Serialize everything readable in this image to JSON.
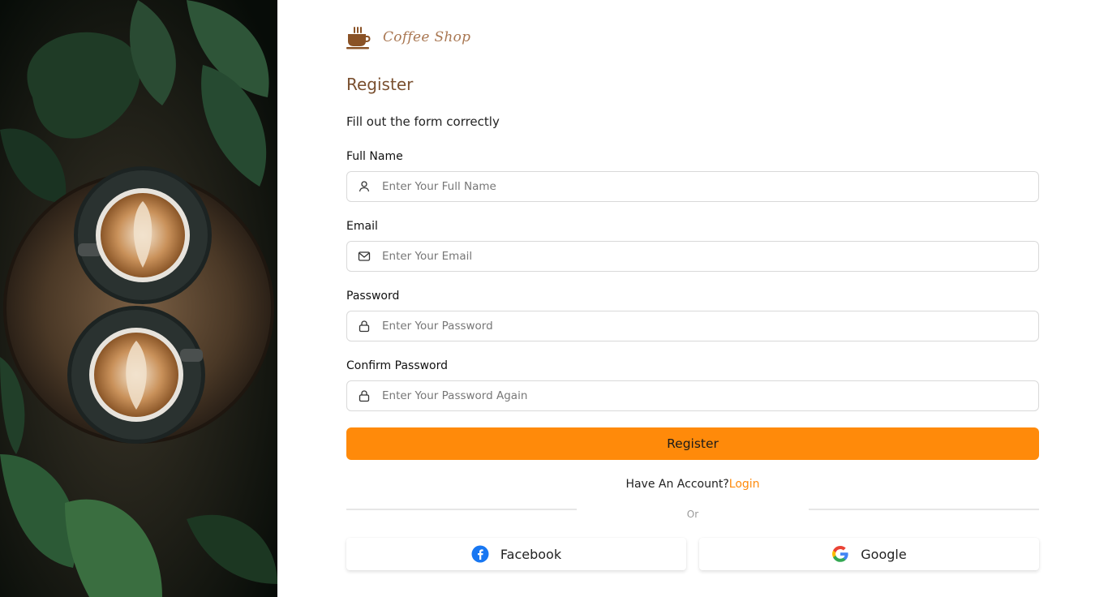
{
  "brand": {
    "name": "Coffee Shop",
    "icon": "coffee-cup-icon",
    "color": "#a97752"
  },
  "form": {
    "title": "Register",
    "subtitle": "Fill out the form correctly",
    "fields": {
      "full_name": {
        "label": "Full Name",
        "placeholder": "Enter Your Full Name",
        "value": "",
        "icon": "user-icon"
      },
      "email": {
        "label": "Email",
        "placeholder": "Enter Your Email",
        "value": "",
        "icon": "mail-icon"
      },
      "password": {
        "label": "Password",
        "placeholder": "Enter Your Password",
        "value": "",
        "icon": "lock-icon"
      },
      "confirm_password": {
        "label": "Confirm Password",
        "placeholder": "Enter Your Password Again",
        "value": "",
        "icon": "lock-icon"
      }
    },
    "register_button": "Register",
    "have_account_text": "Have An Account?",
    "login_link": "Login",
    "or_text": "Or",
    "social": {
      "facebook": {
        "label": "Facebook",
        "icon": "facebook-icon"
      },
      "google": {
        "label": "Google",
        "icon": "google-icon"
      }
    }
  },
  "colors": {
    "accent": "#ff8a0a",
    "title": "#7a5030",
    "input_border": "#d9d9d9",
    "facebook": "#1877f2"
  }
}
